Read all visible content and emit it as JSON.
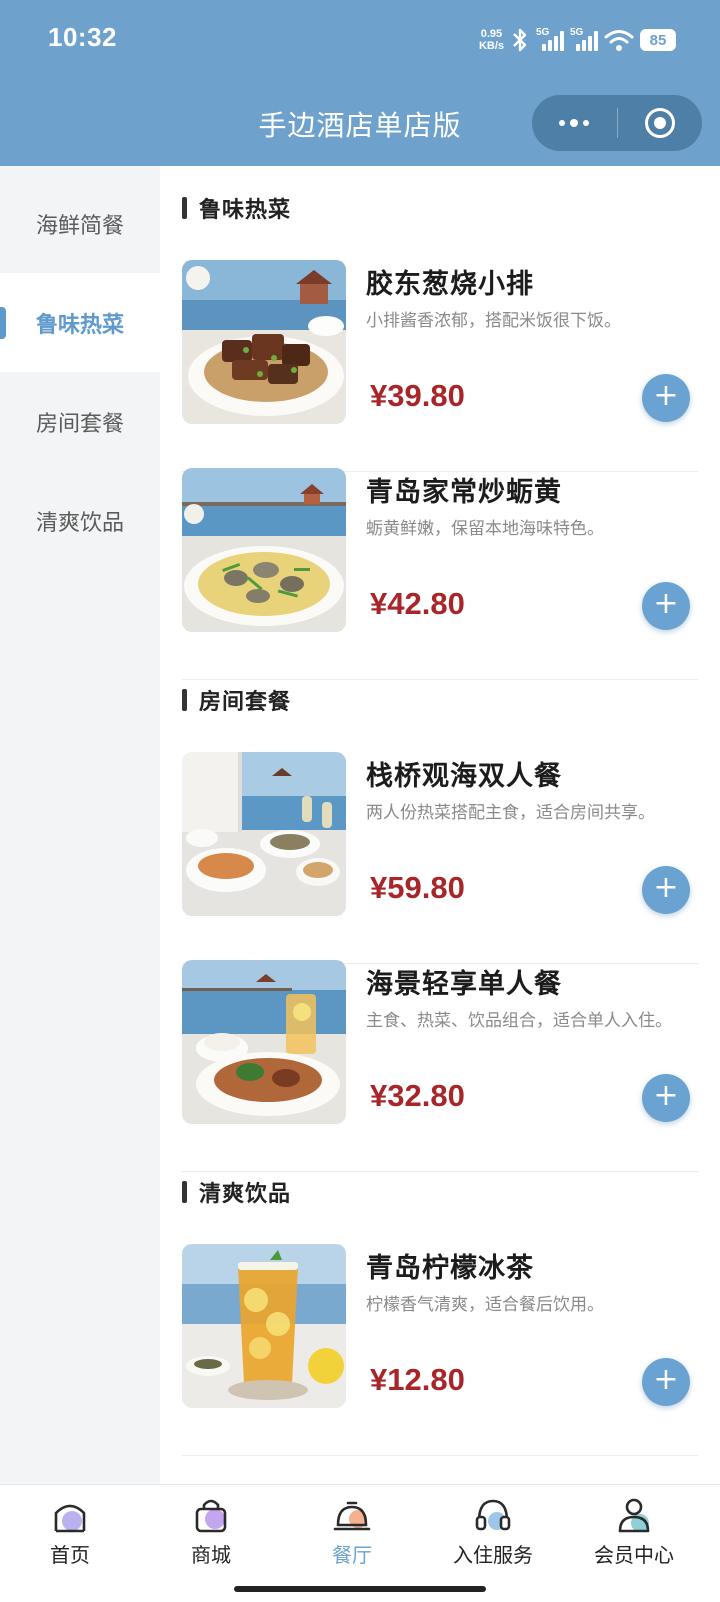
{
  "status_bar": {
    "time": "10:32",
    "net_speed_value": "0.95",
    "net_speed_unit": "KB/s",
    "signal1_label": "5G",
    "signal2_label": "5G",
    "battery": "85",
    "icons": [
      "bluetooth-icon",
      "signal-icon",
      "signal-icon",
      "wifi-icon",
      "battery-icon"
    ]
  },
  "header": {
    "title": "手边酒店单店版",
    "capsule_icons": [
      "more-dots-icon",
      "close-target-icon"
    ]
  },
  "sidebar": {
    "items": [
      {
        "label": "海鲜简餐",
        "active": false
      },
      {
        "label": "鲁味热菜",
        "active": true
      },
      {
        "label": "房间套餐",
        "active": false
      },
      {
        "label": "清爽饮品",
        "active": false
      }
    ]
  },
  "sections": [
    {
      "title": "鲁味热菜",
      "dishes": [
        {
          "name": "胶东葱烧小排",
          "desc": "小排酱香浓郁，搭配米饭很下饭。",
          "price": "¥39.80",
          "image": "braised-ribs-photo"
        },
        {
          "name": "青岛家常炒蛎黄",
          "desc": "蛎黄鲜嫩，保留本地海味特色。",
          "price": "¥42.80",
          "image": "fried-oyster-photo"
        }
      ]
    },
    {
      "title": "房间套餐",
      "dishes": [
        {
          "name": "栈桥观海双人餐",
          "desc": "两人份热菜搭配主食，适合房间共享。",
          "price": "¥59.80",
          "image": "set-meal-for-two-photo"
        },
        {
          "name": "海景轻享单人餐",
          "desc": "主食、热菜、饮品组合，适合单人入住。",
          "price": "¥32.80",
          "image": "set-meal-for-one-photo"
        }
      ]
    },
    {
      "title": "清爽饮品",
      "dishes": [
        {
          "name": "青岛柠檬冰茶",
          "desc": "柠檬香气清爽，适合餐后饮用。",
          "price": "¥12.80",
          "image": "lemon-iced-tea-photo"
        }
      ]
    }
  ],
  "tabbar": {
    "items": [
      {
        "label": "首页",
        "icon": "home-icon",
        "active": false
      },
      {
        "label": "商城",
        "icon": "shopping-bag-icon",
        "active": false
      },
      {
        "label": "餐厅",
        "icon": "restaurant-bell-icon",
        "active": true
      },
      {
        "label": "入住服务",
        "icon": "headset-icon",
        "active": false
      },
      {
        "label": "会员中心",
        "icon": "member-icon",
        "active": false
      }
    ]
  },
  "colors": {
    "header_bg": "#6ea2cd",
    "accent": "#5e9acb",
    "price": "#a8262a",
    "add_button": "#6aa3d2"
  }
}
